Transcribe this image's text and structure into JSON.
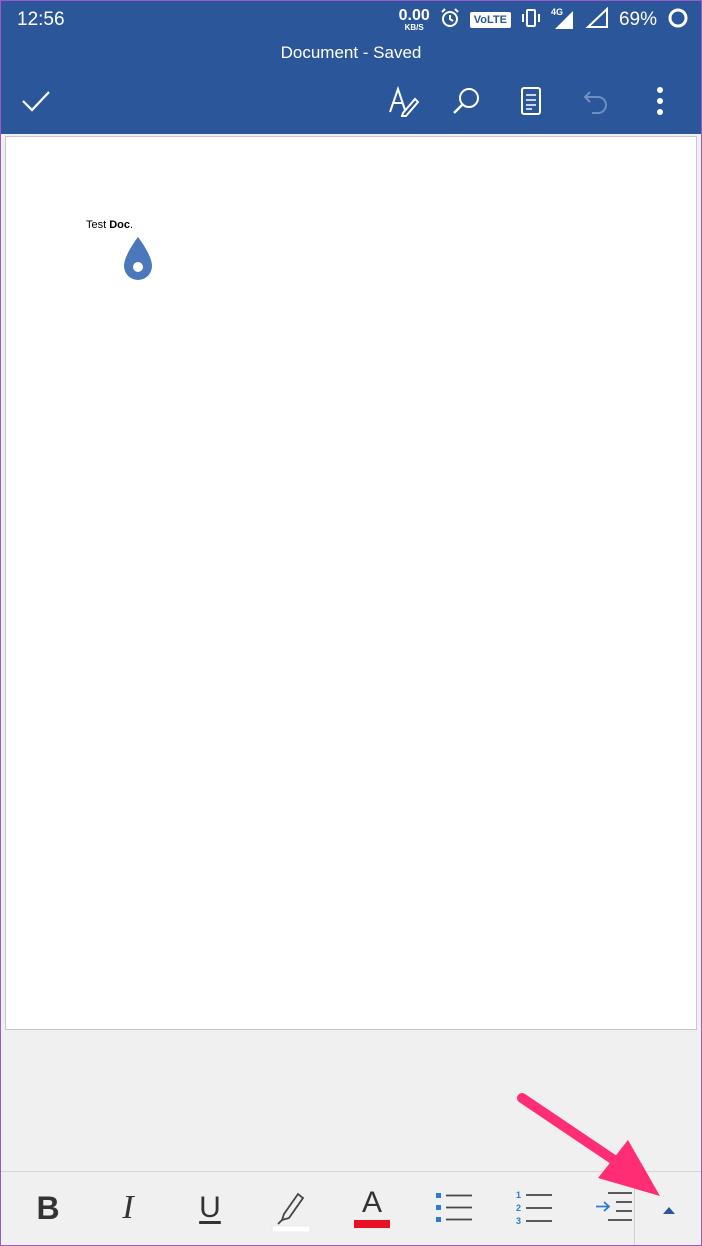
{
  "status_bar": {
    "time": "12:56",
    "net_speed_value": "0.00",
    "net_speed_unit": "KB/S",
    "volte_label": "VoLTE",
    "network_type": "4G",
    "battery_percent": "69%"
  },
  "app_bar": {
    "title": "Document - Saved",
    "icons": [
      "check-icon",
      "draw-pen-icon",
      "search-icon",
      "reading-view-icon",
      "undo-icon",
      "more-vertical-icon"
    ]
  },
  "document": {
    "text_normal": "Test ",
    "text_bold": "Doc",
    "text_end": "."
  },
  "format_toolbar": {
    "bold_label": "B",
    "italic_label": "I",
    "underline_label": "U",
    "font_color_label": "A",
    "font_color": "#e81123",
    "highlight_color": "#ffffff",
    "icons": [
      "highlighter-icon",
      "bullet-list-icon",
      "numbered-list-icon",
      "indent-icon",
      "expand-up-icon"
    ]
  },
  "colors": {
    "accent": "#2b579a",
    "annotation_arrow": "#ff2e74"
  }
}
